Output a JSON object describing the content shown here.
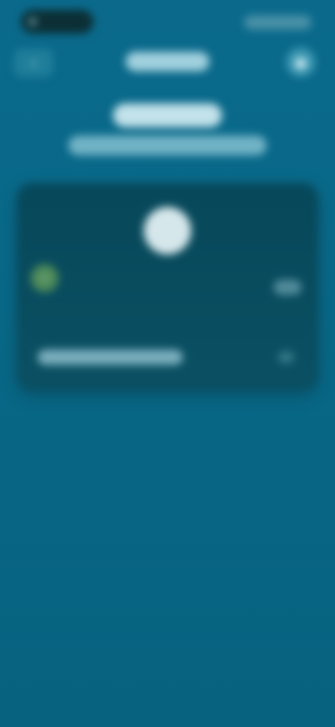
{
  "colors": {
    "background_top": "#0b6a8c",
    "background_bottom": "#07627f",
    "card": "#07485a",
    "status_pill": "#0c2f35",
    "accent_green": "#4e8b59"
  },
  "icons": {
    "back": "chevron-left-icon",
    "action": "circle-icon",
    "avatar": "avatar-icon",
    "left_card": "check-icon",
    "right_card": "chevron-right-icon",
    "footer": "info-icon"
  }
}
